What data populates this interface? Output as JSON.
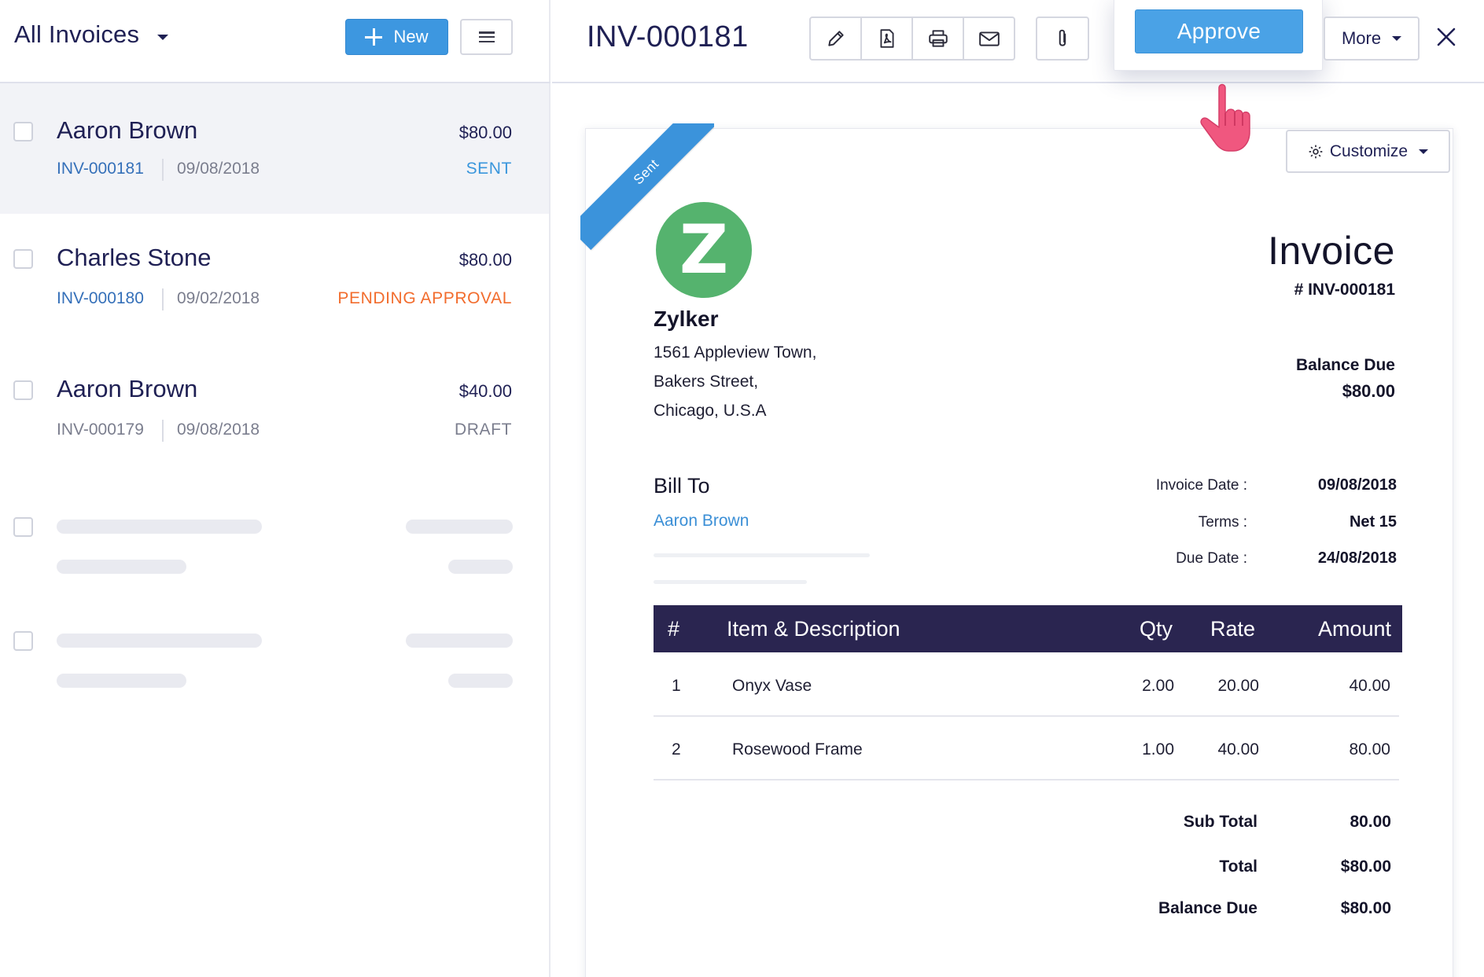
{
  "list": {
    "title": "All Invoices",
    "new_label": "New",
    "rows": [
      {
        "name": "Aaron Brown",
        "amount": "$80.00",
        "invoice": "INV-000181",
        "date": "09/08/2018",
        "status": "SENT",
        "status_color": "#3a96dc"
      },
      {
        "name": "Charles Stone",
        "amount": "$80.00",
        "invoice": "INV-000180",
        "date": "09/02/2018",
        "status": "PENDING APPROVAL",
        "status_color": "#f26c2d"
      },
      {
        "name": "Aaron Brown",
        "amount": "$40.00",
        "invoice": "INV-000179",
        "date": "09/08/2018",
        "status": "DRAFT",
        "status_color": "#7b7e8e"
      }
    ]
  },
  "toolbar": {
    "invoice_title": "INV-000181",
    "icons": [
      "pencil-icon",
      "pdf-icon",
      "printer-icon",
      "mail-icon",
      "paperclip-icon"
    ],
    "approve_label": "Approve",
    "more_label": "More",
    "customize_label": "Customize"
  },
  "invoice": {
    "ribbon": "Sent",
    "logo_letter": "Z",
    "org_name": "Zylker",
    "address": [
      "1561 Appleview Town,",
      "Bakers Street,",
      "Chicago, U.S.A"
    ],
    "title": "Invoice",
    "number": "# INV-000181",
    "balance_due_label": "Balance Due",
    "balance_due": "$80.00",
    "bill_to_label": "Bill To",
    "bill_to_name": "Aaron Brown",
    "meta": [
      {
        "label": "Invoice Date :",
        "value": "09/08/2018"
      },
      {
        "label": "Terms :",
        "value": "Net 15"
      },
      {
        "label": "Due Date :",
        "value": "24/08/2018"
      }
    ],
    "table_headers": {
      "num": "#",
      "item": "Item & Description",
      "qty": "Qty",
      "rate": "Rate",
      "amount": "Amount"
    },
    "items": [
      {
        "num": "1",
        "item": "Onyx Vase",
        "qty": "2.00",
        "rate": "20.00",
        "amount": "40.00"
      },
      {
        "num": "2",
        "item": "Rosewood Frame",
        "qty": "1.00",
        "rate": "40.00",
        "amount": "80.00"
      }
    ],
    "totals": [
      {
        "label": "Sub Total",
        "value": "80.00"
      },
      {
        "label": "Total",
        "value": "$80.00"
      },
      {
        "label": "Balance Due",
        "value": "$80.00"
      }
    ]
  },
  "colors": {
    "accent": "#3d97e0",
    "table_header": "#2a2550",
    "logo": "#55b36e",
    "pending": "#f26c2d"
  }
}
